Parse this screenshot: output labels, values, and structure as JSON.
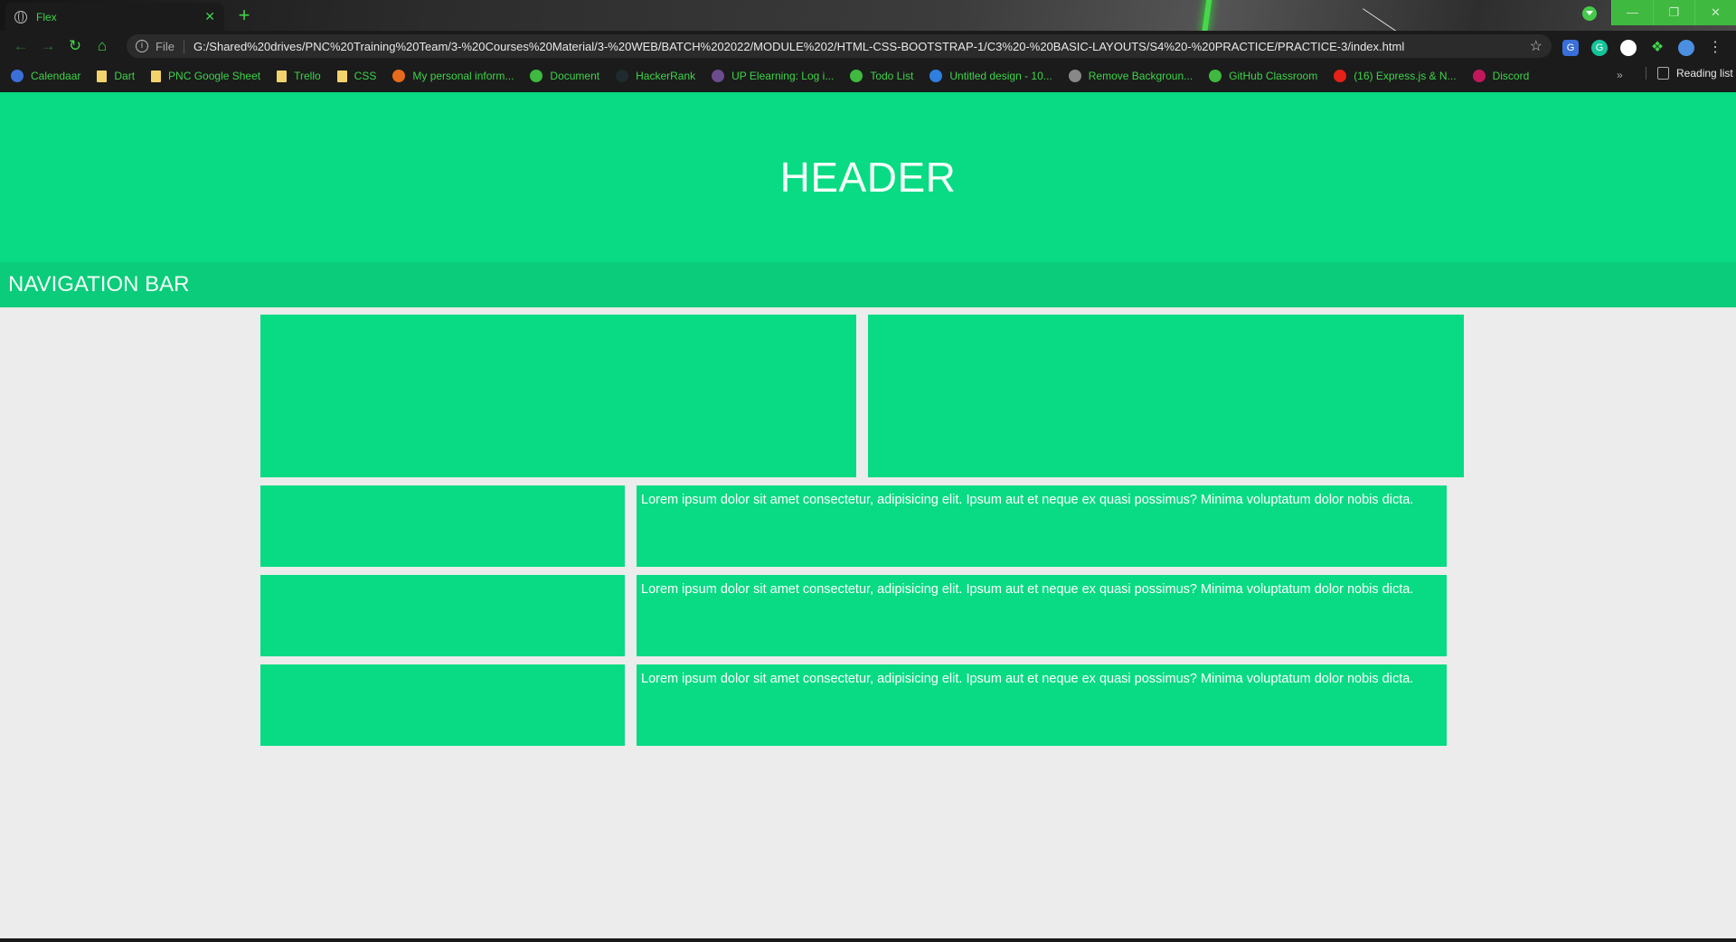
{
  "browser": {
    "tab_title": "Flex",
    "tab_close": "✕",
    "new_tab": "+",
    "scheme": "File",
    "url": "G:/Shared%20drives/PNC%20Training%20Team/3-%20Courses%20Material/3-%20WEB/BATCH%202022/MODULE%202/HTML-CSS-BOOTSTRAP-1/C3%20-%20BASIC-LAYOUTS/S4%20-%20PRACTICE/PRACTICE-3/index.html",
    "window_controls": [
      "—",
      "❐",
      "✕"
    ],
    "bookmarks": [
      {
        "label": "Calendaar",
        "icon": "calendar-icon",
        "color": "#3b6fd8"
      },
      {
        "label": "Dart",
        "icon": "folder-icon",
        "color": "#f2d36b"
      },
      {
        "label": "PNC Google Sheet",
        "icon": "folder-icon",
        "color": "#f2d36b"
      },
      {
        "label": "Trello",
        "icon": "folder-icon",
        "color": "#f2d36b"
      },
      {
        "label": "CSS",
        "icon": "folder-icon",
        "color": "#f2d36b"
      },
      {
        "label": "My personal inform...",
        "icon": "firefox-icon",
        "color": "#e66b1d"
      },
      {
        "label": "Document",
        "icon": "globe-icon",
        "color": "#3fb93f"
      },
      {
        "label": "HackerRank",
        "icon": "hackerrank-icon",
        "color": "#1e2a2e"
      },
      {
        "label": "UP Elearning: Log i...",
        "icon": "shield-icon",
        "color": "#6b4c8c"
      },
      {
        "label": "Todo List",
        "icon": "globe-icon",
        "color": "#3fb93f"
      },
      {
        "label": "Untitled design - 10...",
        "icon": "canva-icon",
        "color": "#2f7fe0"
      },
      {
        "label": "Remove Backgroun...",
        "icon": "layers-icon",
        "color": "#888888"
      },
      {
        "label": "GitHub Classroom",
        "icon": "github-icon",
        "color": "#3fb93f"
      },
      {
        "label": "(16) Express.js & N...",
        "icon": "youtube-icon",
        "color": "#e62117"
      },
      {
        "label": "Discord",
        "icon": "discord-icon",
        "color": "#c2185b"
      }
    ],
    "bookmarks_overflow": "»",
    "reading_list": "Reading list"
  },
  "page": {
    "header": "HEADER",
    "nav": "NAVIGATION BAR",
    "lorem": [
      "Lorem ipsum dolor sit amet consectetur, adipisicing elit. Ipsum aut et neque ex quasi possimus? Minima voluptatum dolor nobis dicta.",
      "Lorem ipsum dolor sit amet consectetur, adipisicing elit. Ipsum aut et neque ex quasi possimus? Minima voluptatum dolor nobis dicta.",
      "Lorem ipsum dolor sit amet consectetur, adipisicing elit. Ipsum aut et neque ex quasi possimus? Minima voluptatum dolor nobis dicta."
    ]
  },
  "colors": {
    "accent": "#08db83",
    "nav": "#0acc7a",
    "background": "#ececec",
    "browser_accent": "#3fd34a"
  }
}
